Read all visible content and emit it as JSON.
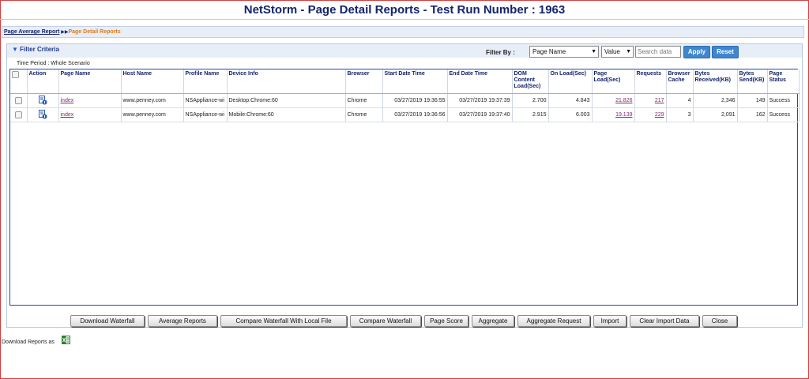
{
  "title": "NetStorm - Page Detail Reports - Test Run Number : 1963",
  "breadcrumb": {
    "link": "Page Average Report",
    "current": "Page Detail Reports"
  },
  "filter": {
    "toggle_label": "Filter Criteria",
    "filter_by_label": "Filter By :",
    "field_select": "Page Name",
    "value_select": "Value",
    "search_placeholder": "Search data",
    "apply_label": "Apply",
    "reset_label": "Reset",
    "time_period": "Time Period : Whole Scenario"
  },
  "table": {
    "headers": [
      "",
      "Action",
      "Page Name",
      "Host Name",
      "Profile Name",
      "Device Info",
      "Browser",
      "Start Date Time",
      "End Date Time",
      "DOM Content Load(Sec)",
      "On Load(Sec)",
      "Page Load(Sec)",
      "Requests",
      "Browser Cache",
      "Bytes Received(KB)",
      "Bytes Send(KB)",
      "Page Status"
    ],
    "rows": [
      {
        "page": "index",
        "host": "www.penney.com",
        "profile": "NSAppliance-wi",
        "device": "Desktop:Chrome:60",
        "browser": "Chrome",
        "start": "03/27/2019 19:36:55",
        "end": "03/27/2019 19:37:39",
        "dom": "2.700",
        "onload": "4.843",
        "pageload": "21.826",
        "requests": "217",
        "cache": "4",
        "recv": "2,346",
        "send": "149",
        "status": "Success"
      },
      {
        "page": "index",
        "host": "www.penney.com",
        "profile": "NSAppliance-wi",
        "device": "Mobile:Chrome:60",
        "browser": "Chrome",
        "start": "03/27/2019 19:36:56",
        "end": "03/27/2019 19:37:40",
        "dom": "2.915",
        "onload": "6.003",
        "pageload": "19.139",
        "requests": "229",
        "cache": "3",
        "recv": "2,091",
        "send": "162",
        "status": "Success"
      }
    ]
  },
  "buttons": {
    "download_waterfall": "Download Waterfall",
    "average_reports": "Average Reports",
    "compare_local": "Compare Waterfall With Local File",
    "compare_waterfall": "Compare Waterfall",
    "page_score": "Page Score",
    "aggregate": "Aggregate",
    "aggregate_request": "Aggregate Request",
    "import": "Import",
    "clear_import": "Clear Import Data",
    "close": "Close"
  },
  "footer": {
    "download_reports_as": "Download Reports as"
  },
  "colors": {
    "title": "#14236e",
    "accent": "#3f86cf",
    "current_crumb": "#e07a18",
    "link": "#7a2a70"
  }
}
